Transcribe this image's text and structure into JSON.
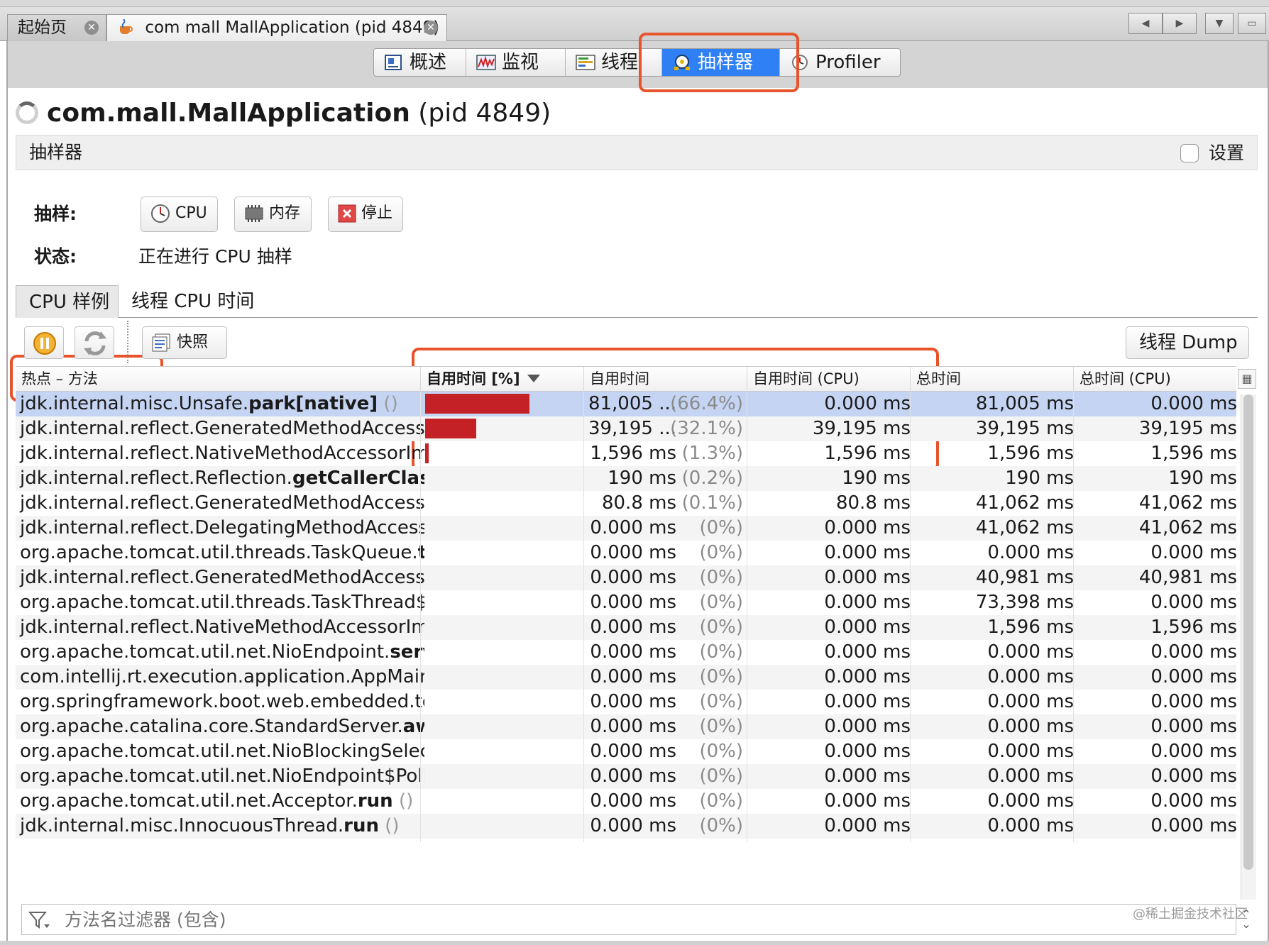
{
  "doc_tabs": [
    {
      "label": "起始页",
      "active": false
    },
    {
      "label": "com mall MallApplication (pid 4849)",
      "active": true
    }
  ],
  "subtabs": [
    {
      "label": "概述",
      "icon": "overview-icon"
    },
    {
      "label": "监视",
      "icon": "monitor-chart-icon"
    },
    {
      "label": "线程",
      "icon": "threads-icon"
    },
    {
      "label": "抽样器",
      "icon": "sampler-icon",
      "active": true
    },
    {
      "label": "Profiler",
      "icon": "profiler-clock-icon"
    }
  ],
  "title": {
    "app": "com.mall.MallApplication",
    "pid": "(pid 4849)"
  },
  "section": {
    "title": "抽样器",
    "settings_label": "设置"
  },
  "sampling": {
    "label": "抽样:",
    "cpu_button": "CPU",
    "memory_button": "内存",
    "stop_button": "停止",
    "status_label": "状态:",
    "status_value": "正在进行 CPU 抽样"
  },
  "inner_tabs": [
    "CPU 样例",
    "线程 CPU 时间"
  ],
  "toolbar": {
    "snapshot_label": "快照",
    "thread_dump_label": "线程 Dump"
  },
  "table": {
    "headers": [
      "热点 – 方法",
      "自用时间 [%]",
      "自用时间",
      "自用时间 (CPU)",
      "总时间",
      "总时间 (CPU)"
    ],
    "rows": [
      {
        "pre": "jdk.internal.misc.Unsafe.",
        "bold": "park[native]",
        "post": " ()",
        "self_val": "81,005 ...",
        "self_pct": "(66.4%)",
        "bar": 0.664,
        "self_cpu": "0.000 ms",
        "total": "81,005 ms",
        "total_cpu": "0.000 ms"
      },
      {
        "pre": "jdk.internal.reflect.GeneratedMethodAccesso",
        "bold": "",
        "post": "",
        "self_val": "39,195 ...",
        "self_pct": "(32.1%)",
        "bar": 0.321,
        "self_cpu": "39,195 ms",
        "total": "39,195 ms",
        "total_cpu": "39,195 ms"
      },
      {
        "pre": "jdk.internal.reflect.NativeMethodAccessorIm",
        "bold": "",
        "post": "",
        "self_val": "1,596 ms",
        "self_pct": "(1.3%)",
        "bar": 0.013,
        "self_cpu": "1,596 ms",
        "total": "1,596 ms",
        "total_cpu": "1,596 ms"
      },
      {
        "pre": "jdk.internal.reflect.Reflection.",
        "bold": "getCallerClass",
        "post": "",
        "self_val": "190 ms",
        "self_pct": "(0.2%)",
        "bar": 0,
        "self_cpu": "190 ms",
        "total": "190 ms",
        "total_cpu": "190 ms"
      },
      {
        "pre": "jdk.internal.reflect.GeneratedMethodAccesso",
        "bold": "",
        "post": "",
        "self_val": "80.8 ms",
        "self_pct": "(0.1%)",
        "bar": 0,
        "self_cpu": "80.8 ms",
        "total": "41,062 ms",
        "total_cpu": "41,062 ms"
      },
      {
        "pre": "jdk.internal.reflect.DelegatingMethodAccesso",
        "bold": "",
        "post": "",
        "self_val": "0.000 ms",
        "self_pct": "(0%)",
        "bar": 0,
        "self_cpu": "0.000 ms",
        "total": "41,062 ms",
        "total_cpu": "41,062 ms"
      },
      {
        "pre": "org.apache.tomcat.util.threads.TaskQueue.",
        "bold": "take",
        "post": "",
        "self_val": "0.000 ms",
        "self_pct": "(0%)",
        "bar": 0,
        "self_cpu": "0.000 ms",
        "total": "0.000 ms",
        "total_cpu": "0.000 ms"
      },
      {
        "pre": "jdk.internal.reflect.GeneratedMethodAccesso",
        "bold": "",
        "post": "",
        "self_val": "0.000 ms",
        "self_pct": "(0%)",
        "bar": 0,
        "self_cpu": "0.000 ms",
        "total": "40,981 ms",
        "total_cpu": "40,981 ms"
      },
      {
        "pre": "org.apache.tomcat.util.threads.TaskThread$Wr",
        "bold": "",
        "post": "",
        "self_val": "0.000 ms",
        "self_pct": "(0%)",
        "bar": 0,
        "self_cpu": "0.000 ms",
        "total": "73,398 ms",
        "total_cpu": "0.000 ms"
      },
      {
        "pre": "jdk.internal.reflect.NativeMethodAccessorIm",
        "bold": "",
        "post": "",
        "self_val": "0.000 ms",
        "self_pct": "(0%)",
        "bar": 0,
        "self_cpu": "0.000 ms",
        "total": "1,596 ms",
        "total_cpu": "1,596 ms"
      },
      {
        "pre": "org.apache.tomcat.util.net.NioEndpoint.",
        "bold": "serve",
        "post": "",
        "self_val": "0.000 ms",
        "self_pct": "(0%)",
        "bar": 0,
        "self_cpu": "0.000 ms",
        "total": "0.000 ms",
        "total_cpu": "0.000 ms"
      },
      {
        "pre": "com.intellij.rt.execution.application.AppMain",
        "bold": "",
        "post": "",
        "self_val": "0.000 ms",
        "self_pct": "(0%)",
        "bar": 0,
        "self_cpu": "0.000 ms",
        "total": "0.000 ms",
        "total_cpu": "0.000 ms"
      },
      {
        "pre": "org.springframework.boot.web.embedded.tom",
        "bold": "",
        "post": "",
        "self_val": "0.000 ms",
        "self_pct": "(0%)",
        "bar": 0,
        "self_cpu": "0.000 ms",
        "total": "0.000 ms",
        "total_cpu": "0.000 ms"
      },
      {
        "pre": "org.apache.catalina.core.StandardServer.",
        "bold": "await",
        "post": "",
        "self_val": "0.000 ms",
        "self_pct": "(0%)",
        "bar": 0,
        "self_cpu": "0.000 ms",
        "total": "0.000 ms",
        "total_cpu": "0.000 ms"
      },
      {
        "pre": "org.apache.tomcat.util.net.NioBlockingSelecto",
        "bold": "",
        "post": "",
        "self_val": "0.000 ms",
        "self_pct": "(0%)",
        "bar": 0,
        "self_cpu": "0.000 ms",
        "total": "0.000 ms",
        "total_cpu": "0.000 ms"
      },
      {
        "pre": "org.apache.tomcat.util.net.NioEndpoint$Polle",
        "bold": "",
        "post": "",
        "self_val": "0.000 ms",
        "self_pct": "(0%)",
        "bar": 0,
        "self_cpu": "0.000 ms",
        "total": "0.000 ms",
        "total_cpu": "0.000 ms"
      },
      {
        "pre": "org.apache.tomcat.util.net.Acceptor.",
        "bold": "run",
        "post": " ()",
        "self_val": "0.000 ms",
        "self_pct": "(0%)",
        "bar": 0,
        "self_cpu": "0.000 ms",
        "total": "0.000 ms",
        "total_cpu": "0.000 ms"
      },
      {
        "pre": "jdk.internal.misc.InnocuousThread.",
        "bold": "run",
        "post": " ()",
        "self_val": "0.000 ms",
        "self_pct": "(0%)",
        "bar": 0,
        "self_cpu": "0.000 ms",
        "total": "0.000 ms",
        "total_cpu": "0.000 ms"
      }
    ]
  },
  "filter": {
    "placeholder": "方法名过滤器 (包含)"
  },
  "watermark": "@稀土掘金技术社区",
  "colors": {
    "accent": "#2f7ff5",
    "highlight": "#e7542b",
    "bar": "#c42127",
    "selected_row": "#c6d4f3"
  }
}
